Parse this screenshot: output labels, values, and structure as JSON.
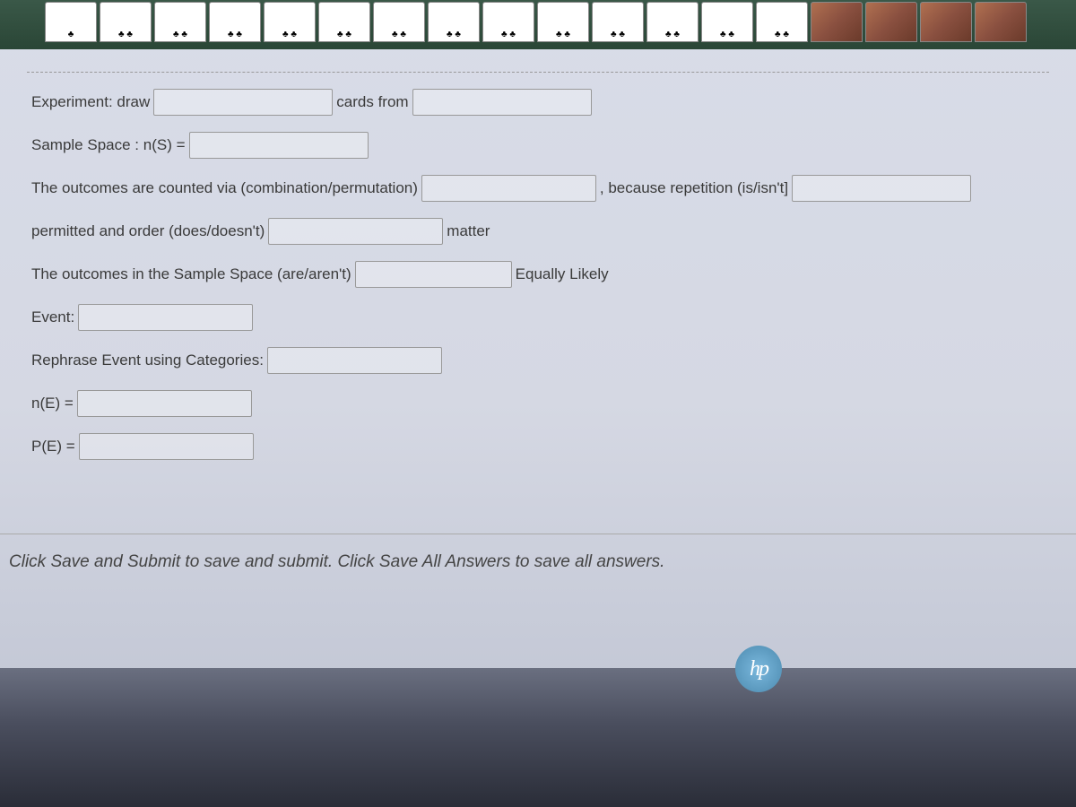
{
  "cards": {
    "count": 18
  },
  "form": {
    "line1": {
      "text1": "Experiment: draw",
      "text2": "cards from"
    },
    "line2": {
      "text1": "Sample Space : n(S) ="
    },
    "line3": {
      "text1": "The outcomes are counted via (combination/permutation)",
      "text2": ", because repetition (is/isn't]"
    },
    "line4": {
      "text1": "permitted and order (does/doesn't)",
      "text2": "matter"
    },
    "line5": {
      "text1": "The outcomes in the Sample Space (are/aren't)",
      "text2": "Equally Likely"
    },
    "line6": {
      "text1": "Event:"
    },
    "line7": {
      "text1": "Rephrase Event using Categories:"
    },
    "line8": {
      "text1": "n(E) ="
    },
    "line9": {
      "text1": "P(E) ="
    }
  },
  "instructions": "Click Save and Submit to save and submit. Click Save All Answers to save all answers.",
  "logo": "hp"
}
